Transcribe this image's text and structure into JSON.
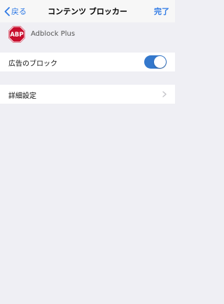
{
  "navbar": {
    "back_label": "戻る",
    "title": "コンテンツ ブロッカー",
    "done_label": "完了"
  },
  "app": {
    "logo_text": "ABP",
    "name": "Adblock Plus"
  },
  "settings": {
    "block_ads_label": "広告のブロック",
    "block_ads_enabled": true,
    "advanced_label": "詳細設定"
  },
  "colors": {
    "accent": "#2f7ae5",
    "toggle_on": "#3478cc",
    "logo_red": "#c70d2c",
    "background": "#efeff4"
  }
}
